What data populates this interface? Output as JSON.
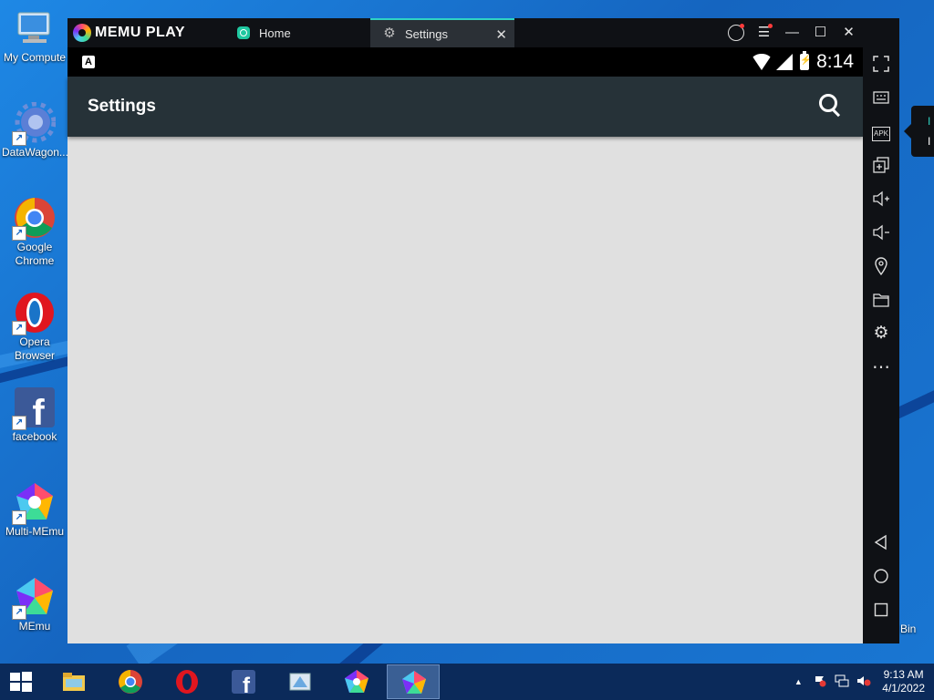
{
  "desktop": {
    "icons": [
      {
        "label": "My Compute",
        "icon": "computer-icon"
      },
      {
        "label": "DataWagon...",
        "icon": "gear-cog-icon"
      },
      {
        "label": "Google Chrome",
        "icon": "chrome-icon"
      },
      {
        "label": "Opera Browser",
        "icon": "opera-icon"
      },
      {
        "label": "facebook",
        "icon": "facebook-icon"
      },
      {
        "label": "Multi-MEmu",
        "icon": "multi-memu-icon"
      },
      {
        "label": "MEmu",
        "icon": "memu-icon"
      }
    ],
    "recycle_bin_label": "Bin"
  },
  "memu": {
    "logo_text": "MEMU PLAY",
    "tabs": [
      {
        "label": "Home",
        "icon": "home-app-icon",
        "active": false
      },
      {
        "label": "Settings",
        "icon": "settings-gear-icon",
        "active": true
      }
    ],
    "tab_close_glyph": "✕",
    "window_controls": {
      "account": "user-icon",
      "menu_glyph": "☰",
      "minimize_glyph": "—",
      "maximize_glyph": "☐",
      "close_glyph": "✕",
      "collapse_glyph": "‹‹‹"
    },
    "accent_color": "#2fd3c3"
  },
  "android": {
    "status_bar": {
      "notification_badge": "A",
      "time": "8:14"
    },
    "app_bar": {
      "title": "Settings",
      "search_icon": "search-icon"
    },
    "content_background": "#e0e0e0"
  },
  "sidebar": {
    "buttons": [
      {
        "name": "fullscreen",
        "glyph": "⛶"
      },
      {
        "name": "keyboard",
        "glyph": "⌨"
      },
      {
        "name": "apk",
        "glyph": "APK"
      },
      {
        "name": "multi-window",
        "glyph": "⧉"
      },
      {
        "name": "volume-up",
        "glyph": "🔈+"
      },
      {
        "name": "volume-down",
        "glyph": "🔈-"
      },
      {
        "name": "location",
        "glyph": "⌖"
      },
      {
        "name": "folder",
        "glyph": "🗀"
      },
      {
        "name": "settings",
        "glyph": "⚙"
      },
      {
        "name": "more",
        "glyph": "⋯"
      },
      {
        "name": "back",
        "glyph": "◁"
      },
      {
        "name": "home",
        "glyph": "○"
      },
      {
        "name": "recents",
        "glyph": "□"
      }
    ]
  },
  "taskbar": {
    "apps": [
      {
        "name": "file-explorer",
        "active": false
      },
      {
        "name": "chrome",
        "active": false
      },
      {
        "name": "opera",
        "active": false
      },
      {
        "name": "facebook",
        "active": false
      },
      {
        "name": "app-window",
        "active": false
      },
      {
        "name": "multi-memu",
        "active": false
      },
      {
        "name": "memu",
        "active": true
      }
    ],
    "tray": {
      "chevron": "▲",
      "clock_time": "9:13 AM",
      "clock_date": "4/1/2022"
    }
  }
}
